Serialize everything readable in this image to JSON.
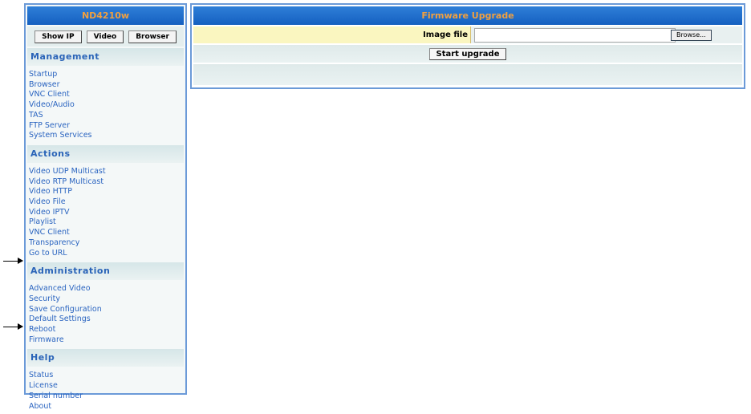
{
  "sidebar": {
    "title": "ND4210w",
    "buttons": [
      "Show IP",
      "Video",
      "Browser"
    ],
    "sections": [
      {
        "title": "Management",
        "items": [
          "Startup",
          "Browser",
          "VNC Client",
          "Video/Audio",
          "TAS",
          "FTP Server",
          "System Services"
        ]
      },
      {
        "title": "Actions",
        "items": [
          "Video UDP Multicast",
          "Video RTP Multicast",
          "Video HTTP",
          "Video File",
          "Video IPTV",
          "Playlist",
          "VNC Client",
          "Transparency",
          "Go to URL"
        ]
      },
      {
        "title": "Administration",
        "items": [
          "Advanced Video",
          "Security",
          "Save Configuration",
          "Default Settings",
          "Reboot",
          "Firmware"
        ]
      },
      {
        "title": "Help",
        "items": [
          "Status",
          "License",
          "Serial number",
          "About"
        ]
      }
    ]
  },
  "main": {
    "title": "Firmware Upgrade",
    "image_file_label": "Image file",
    "image_file_value": "",
    "browse_label": "Browse...",
    "start_label": "Start upgrade"
  }
}
